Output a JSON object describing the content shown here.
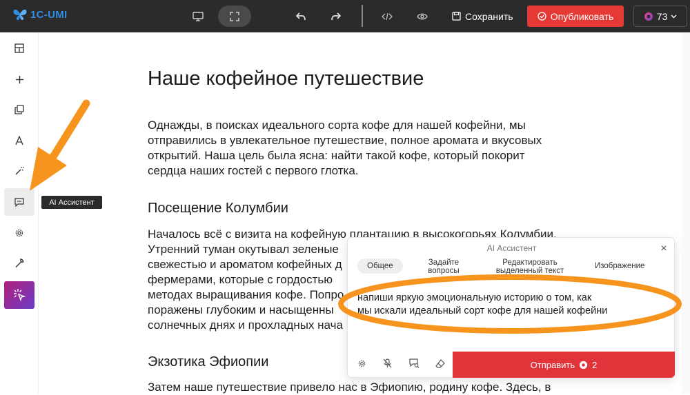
{
  "header": {
    "logo": "1C-UMI",
    "save_label": "Сохранить",
    "publish_label": "Опубликовать",
    "credits": "73"
  },
  "sidebar": {
    "tooltip": "AI Ассистент"
  },
  "article": {
    "title": "Наше кофейное путешествие",
    "intro_lines": [
      "Однажды, в поисках идеального сорта кофе для нашей кофейни, мы",
      "отправились в увлекательное путешествие, полное аромата и вкусовых",
      "открытий. Наша цель была ясна: найти такой кофе, который покорит",
      "сердца наших гостей с первого глотка."
    ],
    "section1_title": "Посещение Колумбии",
    "section1_lines": [
      "Началось всё с визита на кофейную плантацию в высокогорьях Колумбии.",
      "Утренний туман окутывал зеленые",
      "свежестью и ароматом кофейных д",
      "фермерами, которые с гордостью",
      "методах выращивания кофе. Попро",
      "поражены глубоким и насыщенны",
      "солнечных днях и прохладных нача"
    ],
    "section2_title": "Экзотика Эфиопии",
    "section2_line": "Затем наше путешествие привело нас в Эфиопию, родину кофе. Здесь, в"
  },
  "ai_panel": {
    "title": "AI Ассистент",
    "tabs": [
      {
        "label1": "Общее",
        "label2": ""
      },
      {
        "label1": "Задайте",
        "label2": "вопросы"
      },
      {
        "label1": "Редактировать",
        "label2": "выделенный текст"
      },
      {
        "label1": "Изображение",
        "label2": ""
      }
    ],
    "prompt_lines": [
      "напиши яркую эмоциональную историю о том, как",
      "мы искали идеальный сорт кофе для нашей кофейни"
    ],
    "send_label": "Отправить",
    "send_cost": "2"
  },
  "colors": {
    "topbar": "#2b2b2b",
    "accent_red": "#e53935",
    "annotation_orange": "#f7941d",
    "logo_blue": "#2f8fe6"
  }
}
